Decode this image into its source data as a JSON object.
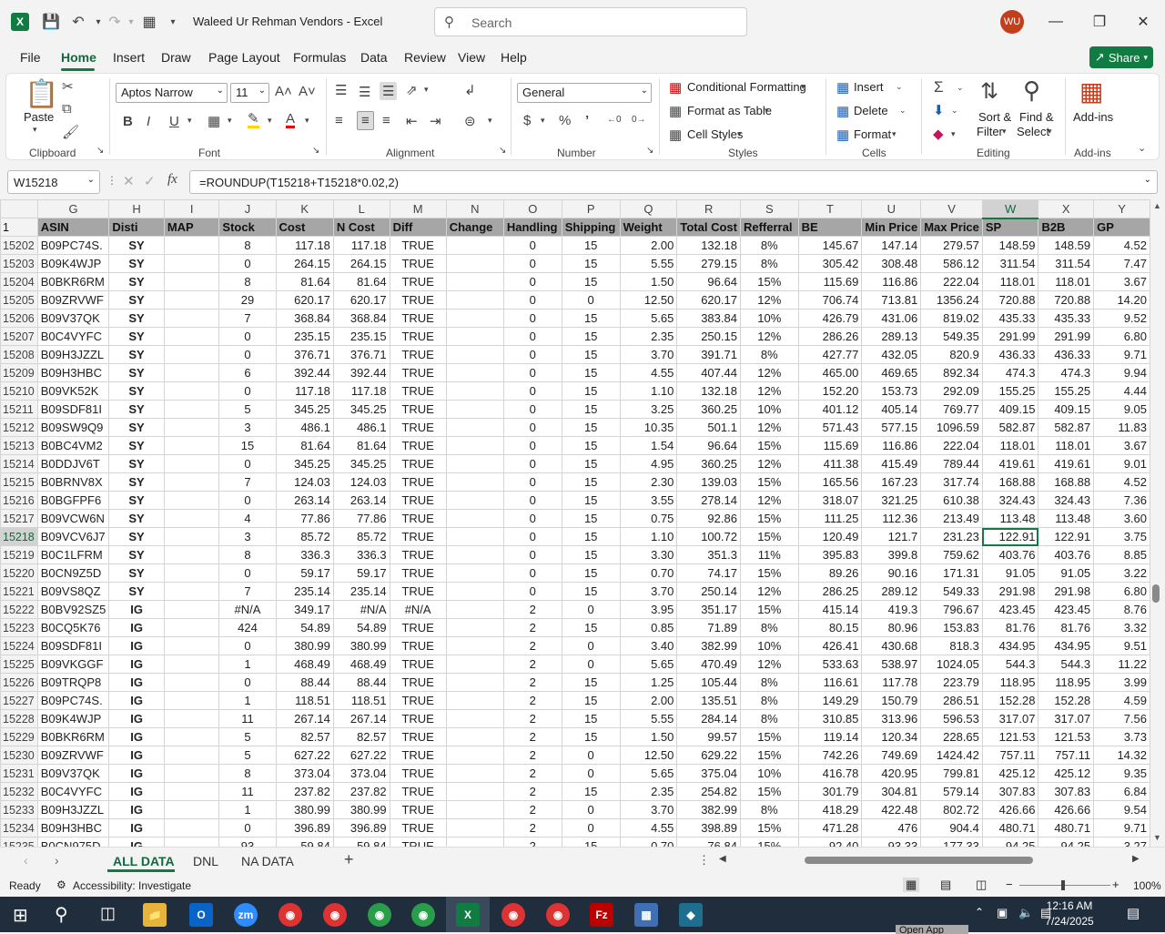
{
  "window": {
    "title": "Waleed Ur Rehman Vendors  -  Excel",
    "search_placeholder": "Search",
    "avatar_initials": "WU"
  },
  "menu": {
    "tabs": [
      "File",
      "Home",
      "Insert",
      "Draw",
      "Page Layout",
      "Formulas",
      "Data",
      "Review",
      "View",
      "Help"
    ],
    "active": "Home",
    "share_label": "Share"
  },
  "ribbon": {
    "paste": "Paste",
    "font_name": "Aptos Narrow",
    "font_size": "11",
    "number_format": "General",
    "conditional_formatting": "Conditional Formatting",
    "format_as_table": "Format as Table",
    "cell_styles": "Cell Styles",
    "insert": "Insert",
    "delete": "Delete",
    "format": "Format",
    "sort_filter_1": "Sort &",
    "sort_filter_2": "Filter",
    "find_select_1": "Find &",
    "find_select_2": "Select",
    "addins": "Add-ins",
    "groups": {
      "clipboard": "Clipboard",
      "font": "Font",
      "alignment": "Alignment",
      "number": "Number",
      "styles": "Styles",
      "cells": "Cells",
      "editing": "Editing",
      "addins": "Add-ins"
    }
  },
  "formula_bar": {
    "name_box": "W15218",
    "formula": "=ROUNDUP(T15218+T15218*0.02,2)"
  },
  "sheet": {
    "columns": [
      "G",
      "H",
      "I",
      "J",
      "K",
      "L",
      "M",
      "N",
      "O",
      "P",
      "Q",
      "R",
      "S",
      "T",
      "U",
      "V",
      "W",
      "X",
      "Y"
    ],
    "selected_column": "W",
    "selected_row": "15218",
    "header_row_number": "1",
    "headers": [
      "ASIN",
      "Disti",
      "MAP",
      "Stock",
      "Cost",
      "N Cost",
      "Diff",
      "Change",
      "Handling",
      "Shipping",
      "Weight",
      "Total Cost",
      "Refferral",
      "BE",
      "Min Price",
      "Max Price",
      "SP",
      "B2B",
      "GP"
    ],
    "rows": [
      [
        "15202",
        "B09PC74S.",
        "SY",
        "",
        "8",
        "117.18",
        "117.18",
        "TRUE",
        "",
        "0",
        "15",
        "2.00",
        "132.18",
        "8%",
        "145.67",
        "147.14",
        "279.57",
        "148.59",
        "148.59",
        "4.52"
      ],
      [
        "15203",
        "B09K4WJP",
        "SY",
        "",
        "0",
        "264.15",
        "264.15",
        "TRUE",
        "",
        "0",
        "15",
        "5.55",
        "279.15",
        "8%",
        "305.42",
        "308.48",
        "586.12",
        "311.54",
        "311.54",
        "7.47"
      ],
      [
        "15204",
        "B0BKR6RM",
        "SY",
        "",
        "8",
        "81.64",
        "81.64",
        "TRUE",
        "",
        "0",
        "15",
        "1.50",
        "96.64",
        "15%",
        "115.69",
        "116.86",
        "222.04",
        "118.01",
        "118.01",
        "3.67"
      ],
      [
        "15205",
        "B09ZRVWF",
        "SY",
        "",
        "29",
        "620.17",
        "620.17",
        "TRUE",
        "",
        "0",
        "0",
        "12.50",
        "620.17",
        "12%",
        "706.74",
        "713.81",
        "1356.24",
        "720.88",
        "720.88",
        "14.20"
      ],
      [
        "15206",
        "B09V37QK",
        "SY",
        "",
        "7",
        "368.84",
        "368.84",
        "TRUE",
        "",
        "0",
        "15",
        "5.65",
        "383.84",
        "10%",
        "426.79",
        "431.06",
        "819.02",
        "435.33",
        "435.33",
        "9.52"
      ],
      [
        "15207",
        "B0C4VYFC",
        "SY",
        "",
        "0",
        "235.15",
        "235.15",
        "TRUE",
        "",
        "0",
        "15",
        "2.35",
        "250.15",
        "12%",
        "286.26",
        "289.13",
        "549.35",
        "291.99",
        "291.99",
        "6.80"
      ],
      [
        "15208",
        "B09H3JZZL",
        "SY",
        "",
        "0",
        "376.71",
        "376.71",
        "TRUE",
        "",
        "0",
        "15",
        "3.70",
        "391.71",
        "8%",
        "427.77",
        "432.05",
        "820.9",
        "436.33",
        "436.33",
        "9.71"
      ],
      [
        "15209",
        "B09H3HBC",
        "SY",
        "",
        "6",
        "392.44",
        "392.44",
        "TRUE",
        "",
        "0",
        "15",
        "4.55",
        "407.44",
        "12%",
        "465.00",
        "469.65",
        "892.34",
        "474.3",
        "474.3",
        "9.94"
      ],
      [
        "15210",
        "B09VK52K",
        "SY",
        "",
        "0",
        "117.18",
        "117.18",
        "TRUE",
        "",
        "0",
        "15",
        "1.10",
        "132.18",
        "12%",
        "152.20",
        "153.73",
        "292.09",
        "155.25",
        "155.25",
        "4.44"
      ],
      [
        "15211",
        "B09SDF81I",
        "SY",
        "",
        "5",
        "345.25",
        "345.25",
        "TRUE",
        "",
        "0",
        "15",
        "3.25",
        "360.25",
        "10%",
        "401.12",
        "405.14",
        "769.77",
        "409.15",
        "409.15",
        "9.05"
      ],
      [
        "15212",
        "B09SW9Q9",
        "SY",
        "",
        "3",
        "486.1",
        "486.1",
        "TRUE",
        "",
        "0",
        "15",
        "10.35",
        "501.1",
        "12%",
        "571.43",
        "577.15",
        "1096.59",
        "582.87",
        "582.87",
        "11.83"
      ],
      [
        "15213",
        "B0BC4VM2",
        "SY",
        "",
        "15",
        "81.64",
        "81.64",
        "TRUE",
        "",
        "0",
        "15",
        "1.54",
        "96.64",
        "15%",
        "115.69",
        "116.86",
        "222.04",
        "118.01",
        "118.01",
        "3.67"
      ],
      [
        "15214",
        "B0DDJV6T",
        "SY",
        "",
        "0",
        "345.25",
        "345.25",
        "TRUE",
        "",
        "0",
        "15",
        "4.95",
        "360.25",
        "12%",
        "411.38",
        "415.49",
        "789.44",
        "419.61",
        "419.61",
        "9.01"
      ],
      [
        "15215",
        "B0BRNV8X",
        "SY",
        "",
        "7",
        "124.03",
        "124.03",
        "TRUE",
        "",
        "0",
        "15",
        "2.30",
        "139.03",
        "15%",
        "165.56",
        "167.23",
        "317.74",
        "168.88",
        "168.88",
        "4.52"
      ],
      [
        "15216",
        "B0BGFPF6",
        "SY",
        "",
        "0",
        "263.14",
        "263.14",
        "TRUE",
        "",
        "0",
        "15",
        "3.55",
        "278.14",
        "12%",
        "318.07",
        "321.25",
        "610.38",
        "324.43",
        "324.43",
        "7.36"
      ],
      [
        "15217",
        "B09VCW6N",
        "SY",
        "",
        "4",
        "77.86",
        "77.86",
        "TRUE",
        "",
        "0",
        "15",
        "0.75",
        "92.86",
        "15%",
        "111.25",
        "112.36",
        "213.49",
        "113.48",
        "113.48",
        "3.60"
      ],
      [
        "15218",
        "B09VCV6J7",
        "SY",
        "",
        "3",
        "85.72",
        "85.72",
        "TRUE",
        "",
        "0",
        "15",
        "1.10",
        "100.72",
        "15%",
        "120.49",
        "121.7",
        "231.23",
        "122.91",
        "122.91",
        "3.75"
      ],
      [
        "15219",
        "B0C1LFRM",
        "SY",
        "",
        "8",
        "336.3",
        "336.3",
        "TRUE",
        "",
        "0",
        "15",
        "3.30",
        "351.3",
        "11%",
        "395.83",
        "399.8",
        "759.62",
        "403.76",
        "403.76",
        "8.85"
      ],
      [
        "15220",
        "B0CN9Z5D",
        "SY",
        "",
        "0",
        "59.17",
        "59.17",
        "TRUE",
        "",
        "0",
        "15",
        "0.70",
        "74.17",
        "15%",
        "89.26",
        "90.16",
        "171.31",
        "91.05",
        "91.05",
        "3.22"
      ],
      [
        "15221",
        "B09VS8QZ",
        "SY",
        "",
        "7",
        "235.14",
        "235.14",
        "TRUE",
        "",
        "0",
        "15",
        "3.70",
        "250.14",
        "12%",
        "286.25",
        "289.12",
        "549.33",
        "291.98",
        "291.98",
        "6.80"
      ],
      [
        "15222",
        "B0BV92SZ5",
        "IG",
        "",
        "#N/A",
        "349.17",
        "#N/A",
        "#N/A",
        "",
        "2",
        "0",
        "3.95",
        "351.17",
        "15%",
        "415.14",
        "419.3",
        "796.67",
        "423.45",
        "423.45",
        "8.76"
      ],
      [
        "15223",
        "B0CQ5K76",
        "IG",
        "",
        "424",
        "54.89",
        "54.89",
        "TRUE",
        "",
        "2",
        "15",
        "0.85",
        "71.89",
        "8%",
        "80.15",
        "80.96",
        "153.83",
        "81.76",
        "81.76",
        "3.32"
      ],
      [
        "15224",
        "B09SDF81I",
        "IG",
        "",
        "0",
        "380.99",
        "380.99",
        "TRUE",
        "",
        "2",
        "0",
        "3.40",
        "382.99",
        "10%",
        "426.41",
        "430.68",
        "818.3",
        "434.95",
        "434.95",
        "9.51"
      ],
      [
        "15225",
        "B09VKGGF",
        "IG",
        "",
        "1",
        "468.49",
        "468.49",
        "TRUE",
        "",
        "2",
        "0",
        "5.65",
        "470.49",
        "12%",
        "533.63",
        "538.97",
        "1024.05",
        "544.3",
        "544.3",
        "11.22"
      ],
      [
        "15226",
        "B09TRQP8",
        "IG",
        "",
        "0",
        "88.44",
        "88.44",
        "TRUE",
        "",
        "2",
        "15",
        "1.25",
        "105.44",
        "8%",
        "116.61",
        "117.78",
        "223.79",
        "118.95",
        "118.95",
        "3.99"
      ],
      [
        "15227",
        "B09PC74S.",
        "IG",
        "",
        "1",
        "118.51",
        "118.51",
        "TRUE",
        "",
        "2",
        "15",
        "2.00",
        "135.51",
        "8%",
        "149.29",
        "150.79",
        "286.51",
        "152.28",
        "152.28",
        "4.59"
      ],
      [
        "15228",
        "B09K4WJP",
        "IG",
        "",
        "11",
        "267.14",
        "267.14",
        "TRUE",
        "",
        "2",
        "15",
        "5.55",
        "284.14",
        "8%",
        "310.85",
        "313.96",
        "596.53",
        "317.07",
        "317.07",
        "7.56"
      ],
      [
        "15229",
        "B0BKR6RM",
        "IG",
        "",
        "5",
        "82.57",
        "82.57",
        "TRUE",
        "",
        "2",
        "15",
        "1.50",
        "99.57",
        "15%",
        "119.14",
        "120.34",
        "228.65",
        "121.53",
        "121.53",
        "3.73"
      ],
      [
        "15230",
        "B09ZRVWF",
        "IG",
        "",
        "5",
        "627.22",
        "627.22",
        "TRUE",
        "",
        "2",
        "0",
        "12.50",
        "629.22",
        "15%",
        "742.26",
        "749.69",
        "1424.42",
        "757.11",
        "757.11",
        "14.32"
      ],
      [
        "15231",
        "B09V37QK",
        "IG",
        "",
        "8",
        "373.04",
        "373.04",
        "TRUE",
        "",
        "2",
        "0",
        "5.65",
        "375.04",
        "10%",
        "416.78",
        "420.95",
        "799.81",
        "425.12",
        "425.12",
        "9.35"
      ],
      [
        "15232",
        "B0C4VYFC",
        "IG",
        "",
        "11",
        "237.82",
        "237.82",
        "TRUE",
        "",
        "2",
        "15",
        "2.35",
        "254.82",
        "15%",
        "301.79",
        "304.81",
        "579.14",
        "307.83",
        "307.83",
        "6.84"
      ],
      [
        "15233",
        "B09H3JZZL",
        "IG",
        "",
        "1",
        "380.99",
        "380.99",
        "TRUE",
        "",
        "2",
        "0",
        "3.70",
        "382.99",
        "8%",
        "418.29",
        "422.48",
        "802.72",
        "426.66",
        "426.66",
        "9.54"
      ],
      [
        "15234",
        "B09H3HBC",
        "IG",
        "",
        "0",
        "396.89",
        "396.89",
        "TRUE",
        "",
        "2",
        "0",
        "4.55",
        "398.89",
        "15%",
        "471.28",
        "476",
        "904.4",
        "480.71",
        "480.71",
        "9.71"
      ],
      [
        "15235",
        "B0CN975D",
        "IG",
        "",
        "93",
        "59.84",
        "59.84",
        "TRUE",
        "",
        "2",
        "15",
        "0.70",
        "76.84",
        "15%",
        "92.40",
        "93.33",
        "177.33",
        "94.25",
        "94.25",
        "3.27"
      ]
    ]
  },
  "sheet_tabs": [
    "ALL DATA",
    "DNL",
    "NA DATA"
  ],
  "active_sheet": "ALL DATA",
  "status": {
    "ready": "Ready",
    "accessibility": "Accessibility: Investigate",
    "zoom": "100%"
  },
  "taskbar": {
    "time": "12:16 AM",
    "date": "7/24/2025",
    "tooltip": "Open App"
  },
  "colors": {
    "excel_green": "#107c41",
    "header_fill": "#a6a6a6",
    "avatar": "#c43e1c"
  }
}
